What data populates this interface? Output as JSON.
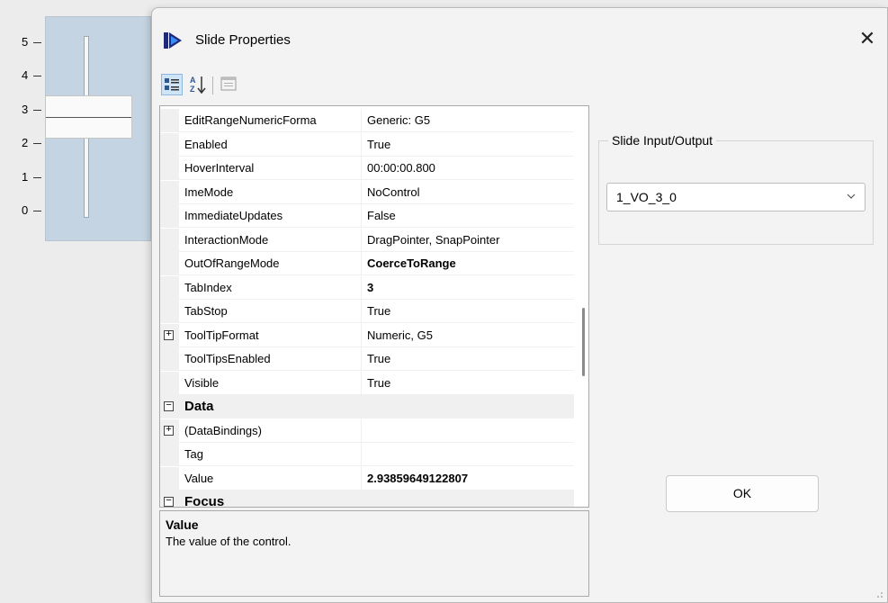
{
  "slider": {
    "ticks": [
      "5",
      "4",
      "3",
      "2",
      "1",
      "0"
    ],
    "value": 2.93859649122807
  },
  "dialog": {
    "title": "Slide Properties",
    "icon": "app-logo-icon",
    "close_label": "✕"
  },
  "toolbar": {
    "categorized": "categorized-icon",
    "alphabetical": "sort-az-icon",
    "property_pages": "property-pages-icon"
  },
  "grid": {
    "rows": [
      {
        "name": "EditRangeNumericForma",
        "value": "Generic: G5",
        "bold": false,
        "expander": ""
      },
      {
        "name": "Enabled",
        "value": "True",
        "bold": false,
        "expander": ""
      },
      {
        "name": "HoverInterval",
        "value": "00:00:00.800",
        "bold": false,
        "expander": ""
      },
      {
        "name": "ImeMode",
        "value": "NoControl",
        "bold": false,
        "expander": ""
      },
      {
        "name": "ImmediateUpdates",
        "value": "False",
        "bold": false,
        "expander": ""
      },
      {
        "name": "InteractionMode",
        "value": "DragPointer, SnapPointer",
        "bold": false,
        "expander": ""
      },
      {
        "name": "OutOfRangeMode",
        "value": "CoerceToRange",
        "bold": true,
        "expander": ""
      },
      {
        "name": "TabIndex",
        "value": "3",
        "bold": true,
        "expander": ""
      },
      {
        "name": "TabStop",
        "value": "True",
        "bold": false,
        "expander": ""
      },
      {
        "name": "ToolTipFormat",
        "value": "Numeric, G5",
        "bold": false,
        "expander": "+"
      },
      {
        "name": "ToolTipsEnabled",
        "value": "True",
        "bold": false,
        "expander": ""
      },
      {
        "name": "Visible",
        "value": "True",
        "bold": false,
        "expander": ""
      },
      {
        "name": "Data",
        "value": "",
        "bold": true,
        "expander": "−",
        "category": true
      },
      {
        "name": "(DataBindings)",
        "value": "",
        "bold": false,
        "expander": "+"
      },
      {
        "name": "Tag",
        "value": "",
        "bold": false,
        "expander": ""
      },
      {
        "name": "Value",
        "value": "2.93859649122807",
        "bold": true,
        "expander": ""
      },
      {
        "name": "Focus",
        "value": "",
        "bold": true,
        "expander": "−",
        "category": true
      }
    ]
  },
  "description": {
    "title": "Value",
    "text": "The value of the control."
  },
  "io": {
    "group_label": "Slide Input/Output",
    "selected": "1_VO_3_0"
  },
  "ok_label": "OK"
}
